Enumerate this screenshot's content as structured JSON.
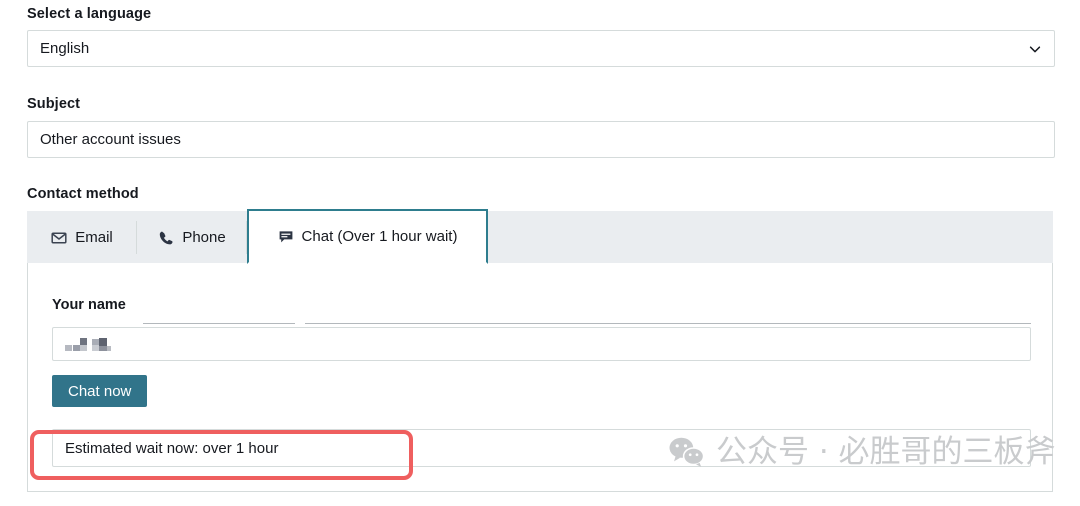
{
  "language": {
    "label": "Select a language",
    "value": "English",
    "chevron_icon": "chevron-down-icon"
  },
  "subject": {
    "label": "Subject",
    "value": "Other account issues"
  },
  "contact_method": {
    "label": "Contact method",
    "tabs": [
      {
        "label": "Email",
        "icon": "envelope-icon",
        "active": false
      },
      {
        "label": "Phone",
        "icon": "phone-icon",
        "active": false
      },
      {
        "label": "Chat (Over 1 hour wait)",
        "icon": "chat-bubble-icon",
        "active": true
      }
    ]
  },
  "chat_panel": {
    "name_label": "Your name",
    "name_value": "",
    "name_redacted": true,
    "submit_label": "Chat now",
    "wait_notice": "Estimated wait now: over 1 hour"
  },
  "watermark": {
    "icon": "wechat-icon",
    "text": "公众号 · 必胜哥的三板斧"
  },
  "colors": {
    "accent_teal": "#31748a",
    "tab_active_border": "#2e7d8e",
    "annotation_red": "#ef5f5f",
    "tabstrip_bg": "#eaedf0",
    "border_grey": "#d5dbdb",
    "text": "#16191f",
    "watermark_grey": "#c9cbcd"
  }
}
